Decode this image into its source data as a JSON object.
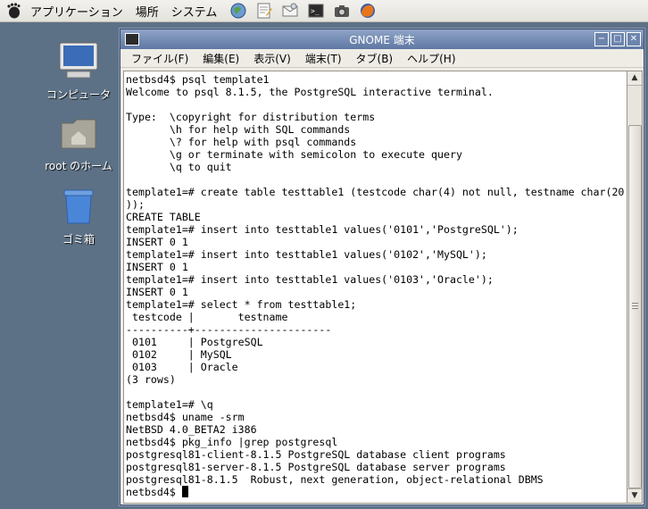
{
  "panel": {
    "menus": [
      "アプリケーション",
      "場所",
      "システム"
    ],
    "launchers": [
      "web-browser-icon",
      "text-editor-icon",
      "mail-icon",
      "terminal-icon",
      "screenshot-icon",
      "firefox-icon"
    ]
  },
  "desktop": {
    "icons": [
      {
        "label": "コンピュータ",
        "icon": "computer-icon"
      },
      {
        "label": "root のホーム",
        "icon": "home-folder-icon"
      },
      {
        "label": "ゴミ箱",
        "icon": "trash-icon"
      }
    ]
  },
  "window": {
    "title": "GNOME 端末",
    "menus": [
      "ファイル(F)",
      "編集(E)",
      "表示(V)",
      "端末(T)",
      "タブ(B)",
      "ヘルプ(H)"
    ],
    "terminal_lines": [
      "netbsd4$ psql template1",
      "Welcome to psql 8.1.5, the PostgreSQL interactive terminal.",
      "",
      "Type:  \\copyright for distribution terms",
      "       \\h for help with SQL commands",
      "       \\? for help with psql commands",
      "       \\g or terminate with semicolon to execute query",
      "       \\q to quit",
      "",
      "template1=# create table testtable1 (testcode char(4) not null, testname char(20",
      "));",
      "CREATE TABLE",
      "template1=# insert into testtable1 values('0101','PostgreSQL');",
      "INSERT 0 1",
      "template1=# insert into testtable1 values('0102','MySQL');",
      "INSERT 0 1",
      "template1=# insert into testtable1 values('0103','Oracle');",
      "INSERT 0 1",
      "template1=# select * from testtable1;",
      " testcode |       testname",
      "----------+----------------------",
      " 0101     | PostgreSQL",
      " 0102     | MySQL",
      " 0103     | Oracle",
      "(3 rows)",
      "",
      "template1=# \\q",
      "netbsd4$ uname -srm",
      "NetBSD 4.0_BETA2 i386",
      "netbsd4$ pkg_info |grep postgresql",
      "postgresql81-client-8.1.5 PostgreSQL database client programs",
      "postgresql81-server-8.1.5 PostgreSQL database server programs",
      "postgresql81-8.1.5  Robust, next generation, object-relational DBMS"
    ],
    "prompt": "netbsd4$ "
  }
}
